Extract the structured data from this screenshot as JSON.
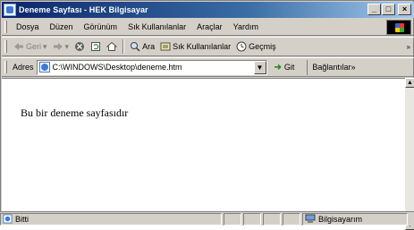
{
  "window": {
    "title": "Deneme Sayfası - HEK Bilgisayar",
    "controls": {
      "minimize": "_",
      "maximize": "□",
      "close": "×"
    }
  },
  "menu": {
    "items": [
      {
        "label": "Dosya"
      },
      {
        "label": "Düzen"
      },
      {
        "label": "Görünüm"
      },
      {
        "label": "Sık Kullanılanlar"
      },
      {
        "label": "Araçlar"
      },
      {
        "label": "Yardım"
      }
    ]
  },
  "toolbar": {
    "back_label": "Geri",
    "search_label": "Ara",
    "favorites_label": "Sık Kullanılanlar",
    "history_label": "Geçmiş",
    "overflow": "»"
  },
  "address": {
    "label": "Adres",
    "value": "C:\\WINDOWS\\Desktop\\deneme.htm",
    "go_label": "Git",
    "links_label": "Bağlantılar",
    "links_overflow": "»"
  },
  "page": {
    "text": "Bu bir deneme sayfasıdır"
  },
  "status": {
    "left": "Bitti",
    "zone": "Bilgisayarım"
  },
  "colors": {
    "titlebar_start": "#0a246a",
    "titlebar_end": "#a6caf0",
    "chrome": "#d4d0c8"
  }
}
